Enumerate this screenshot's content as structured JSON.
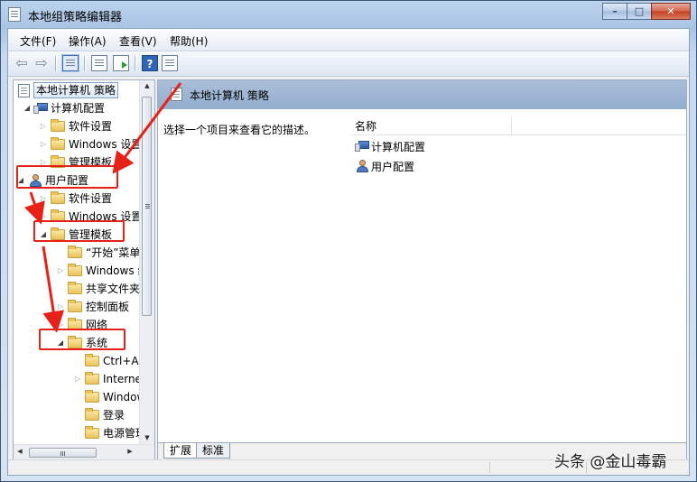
{
  "window": {
    "title": "本地组策略编辑器",
    "buttons": {
      "minimize": "–",
      "maximize": "□",
      "close": "✕"
    }
  },
  "menu": {
    "file": "文件(F)",
    "action": "操作(A)",
    "view": "查看(V)",
    "help": "帮助(H)"
  },
  "toolbar": {
    "back_icon": "back-arrow-icon",
    "forward_icon": "forward-arrow-icon",
    "help_glyph": "?"
  },
  "tree": {
    "root": "本地计算机 策略",
    "computer_config": "计算机配置",
    "cc_software": "软件设置",
    "cc_windows": "Windows 设置",
    "cc_admin": "管理模板",
    "user_config": "用户配置",
    "uc_software": "软件设置",
    "uc_windows": "Windows 设置",
    "uc_admin": "管理模板",
    "start_menu": "“开始”菜单和任务栏",
    "windows_components": "Windows 组件",
    "shared_folders": "共享文件夹",
    "control_panel": "控制面板",
    "network": "网络",
    "system": "系统",
    "ctrl_alt_del": "Ctrl+Alt+Del 选项",
    "internet": "Internet 通信管理",
    "windows_hotstart": "Windows HotStart",
    "logon": "登录",
    "power": "电源管理"
  },
  "right_pane": {
    "header_title": "本地计算机 策略",
    "description": "选择一个项目来查看它的描述。",
    "column_name": "名称",
    "items": [
      "计算机配置",
      "用户配置"
    ]
  },
  "tabs": {
    "extended": "扩展",
    "standard": "标准"
  },
  "watermark": "头条 @金山毒霸",
  "annotation_color": "#e62117"
}
